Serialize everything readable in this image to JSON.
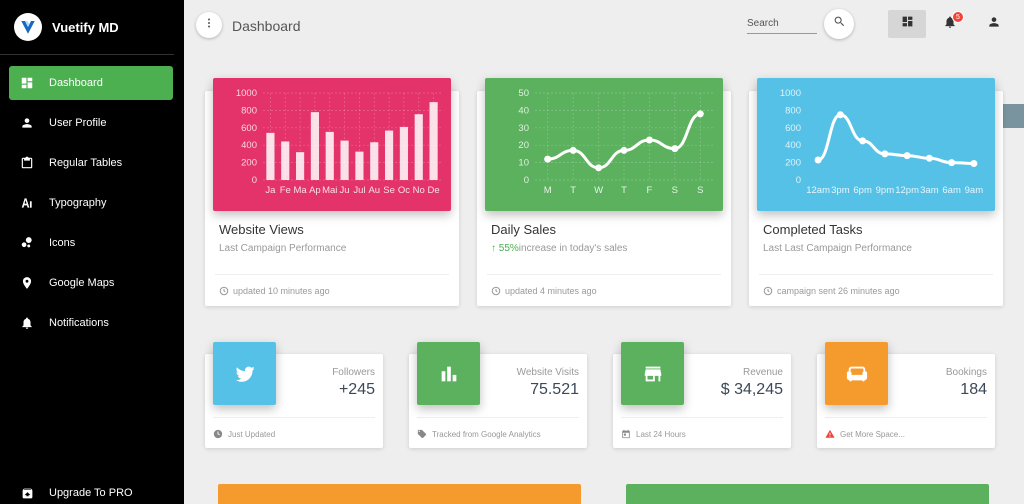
{
  "brand": {
    "name": "Vuetify MD"
  },
  "sidebar": {
    "items": [
      {
        "label": "Dashboard",
        "icon": "dashboard-icon",
        "active": true
      },
      {
        "label": "User Profile",
        "icon": "person-icon"
      },
      {
        "label": "Regular Tables",
        "icon": "clipboard-icon"
      },
      {
        "label": "Typography",
        "icon": "typography-icon"
      },
      {
        "label": "Icons",
        "icon": "bubble-chart-icon"
      },
      {
        "label": "Google Maps",
        "icon": "place-icon"
      },
      {
        "label": "Notifications",
        "icon": "bell-icon"
      }
    ],
    "upgrade": "Upgrade To PRO"
  },
  "toolbar": {
    "title": "Dashboard",
    "search_placeholder": "Search",
    "notification_count": "5"
  },
  "colors": {
    "sidebar_bg": "#000000",
    "active": "#4caf50",
    "red": "#e3336a",
    "green": "#5cb15f",
    "blue": "#56c1e6",
    "orange": "#f59b2e"
  },
  "cards": [
    {
      "title": "Website Views",
      "subtitle": "Last Campaign Performance",
      "footer": "updated 10 minutes ago"
    },
    {
      "title": "Daily Sales",
      "subtitle_value": "55%",
      "subtitle": "increase in today's sales",
      "footer": "updated 4 minutes ago"
    },
    {
      "title": "Completed Tasks",
      "subtitle": "Last Last Campaign Performance",
      "footer": "campaign sent 26 minutes ago"
    }
  ],
  "stats": [
    {
      "category": "Followers",
      "value": "+245",
      "footer": "Just Updated",
      "icon": "twitter-icon",
      "footer_icon": "clock-icon"
    },
    {
      "category": "Website Visits",
      "value": "75.521",
      "footer": "Tracked from Google Analytics",
      "icon": "bar-chart-icon",
      "footer_icon": "tag-icon"
    },
    {
      "category": "Revenue",
      "value": "$ 34,245",
      "footer": "Last 24 Hours",
      "icon": "store-icon",
      "footer_icon": "calendar-icon"
    },
    {
      "category": "Bookings",
      "value": "184",
      "footer": "Get More Space...",
      "icon": "sofa-icon",
      "footer_icon": "warning-icon"
    }
  ],
  "chart_data": [
    {
      "type": "bar",
      "categories": [
        "Ja",
        "Fe",
        "Ma",
        "Ap",
        "Mai",
        "Ju",
        "Jul",
        "Au",
        "Se",
        "Oc",
        "No",
        "De"
      ],
      "values": [
        542,
        443,
        320,
        780,
        553,
        453,
        326,
        434,
        568,
        610,
        756,
        895
      ],
      "yticks": [
        0,
        200,
        400,
        600,
        800,
        1000
      ],
      "ylim": [
        0,
        1000
      ],
      "grid": true
    },
    {
      "type": "line",
      "categories": [
        "M",
        "T",
        "W",
        "T",
        "F",
        "S",
        "S"
      ],
      "values": [
        12,
        17,
        7,
        17,
        23,
        18,
        38
      ],
      "yticks": [
        0,
        10,
        20,
        30,
        40,
        50
      ],
      "ylim": [
        0,
        50
      ],
      "grid": true
    },
    {
      "type": "line",
      "categories": [
        "12am",
        "3pm",
        "6pm",
        "9pm",
        "12pm",
        "3am",
        "6am",
        "9am"
      ],
      "values": [
        230,
        750,
        450,
        300,
        280,
        250,
        200,
        190
      ],
      "yticks": [
        0,
        200,
        400,
        600,
        800,
        1000
      ],
      "ylim": [
        0,
        1000
      ],
      "grid": false
    }
  ]
}
